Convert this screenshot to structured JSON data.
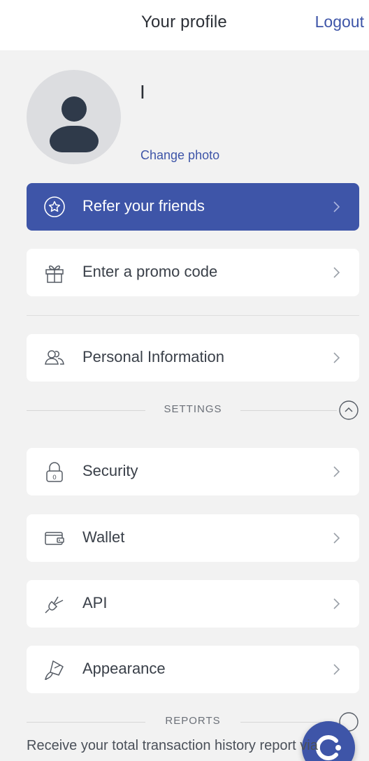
{
  "header": {
    "title": "Your profile",
    "logout_label": "Logout"
  },
  "profile": {
    "name": "I",
    "change_photo_label": "Change photo"
  },
  "menu": {
    "refer": {
      "label": "Refer your friends",
      "icon": "star-circle-icon"
    },
    "promo": {
      "label": "Enter a promo code",
      "icon": "gift-icon"
    },
    "personal": {
      "label": "Personal Information",
      "icon": "users-icon"
    },
    "security": {
      "label": "Security",
      "icon": "padlock-icon"
    },
    "wallet": {
      "label": "Wallet",
      "icon": "wallet-icon"
    },
    "api": {
      "label": "API",
      "icon": "plug-icon"
    },
    "appearance": {
      "label": "Appearance",
      "icon": "paint-brush-icon"
    }
  },
  "sections": {
    "settings": "SETTINGS",
    "reports": "REPORTS"
  },
  "reports_note": "Receive your total transaction history report via",
  "colors": {
    "accent": "#3e55a8",
    "background": "#f2f2f2",
    "card": "#ffffff",
    "text": "#3a4049"
  }
}
